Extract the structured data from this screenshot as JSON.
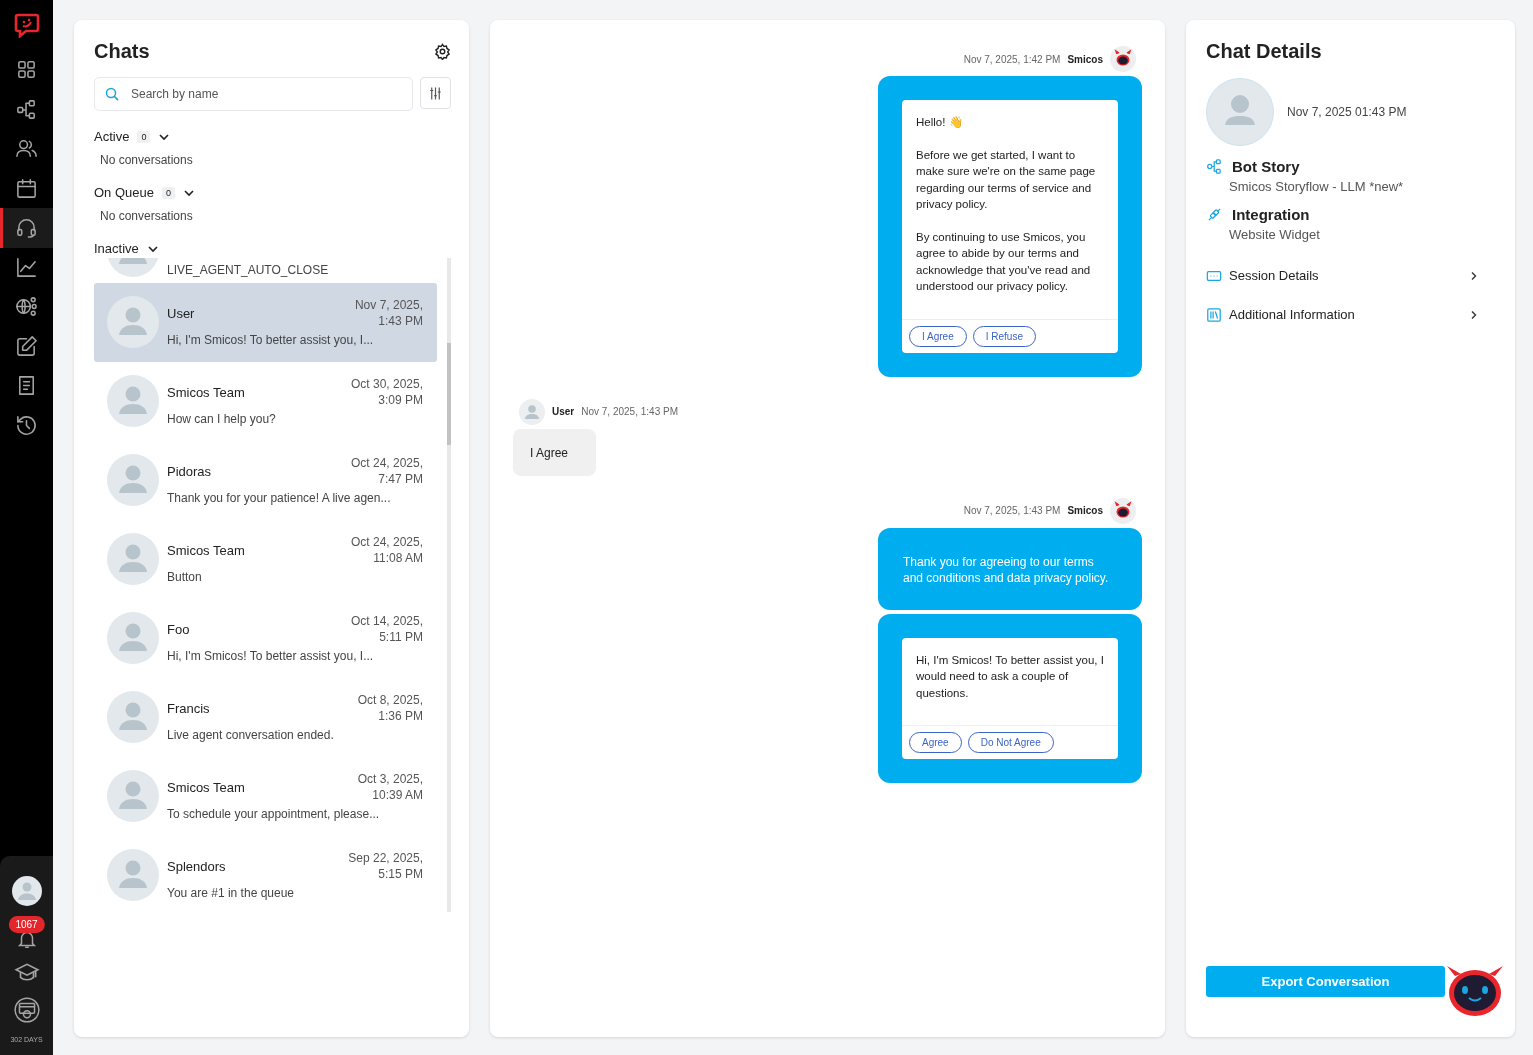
{
  "nav": {
    "items": [
      {
        "selected": false
      },
      {
        "selected": false
      },
      {
        "selected": false
      },
      {
        "selected": false
      },
      {
        "selected": true
      },
      {
        "selected": false
      },
      {
        "selected": false
      },
      {
        "selected": false
      },
      {
        "selected": false
      },
      {
        "selected": false
      }
    ],
    "notifications": "1067",
    "trial": "302 DAYS"
  },
  "chats": {
    "title": "Chats",
    "search": {
      "placeholder": "Search by name"
    },
    "sections": [
      {
        "label": "Active",
        "count": "0",
        "expanded": true,
        "empty": "No conversations"
      },
      {
        "label": "On Queue",
        "count": "0",
        "expanded": true,
        "empty": "No conversations"
      },
      {
        "label": "Inactive",
        "expanded": true
      }
    ],
    "items": [
      {
        "preview": "LIVE_AGENT_AUTO_CLOSE",
        "selected": false
      },
      {
        "name": "User",
        "date": "Nov 7, 2025, 1:43 PM",
        "preview": "Hi, I'm Smicos! To better assist you, I...",
        "selected": true
      },
      {
        "name": "Smicos Team",
        "date": "Oct 30, 2025, 3:09 PM",
        "preview": "How can I help you?",
        "selected": false
      },
      {
        "name": "Pidoras",
        "date": "Oct 24, 2025, 7:47 PM",
        "preview": "Thank you for your patience! A live agen...",
        "selected": false
      },
      {
        "name": "Smicos Team",
        "date": "Oct 24, 2025, 11:08 AM",
        "preview": "Button",
        "selected": false
      },
      {
        "name": "Foo",
        "date": "Oct 14, 2025, 5:11 PM",
        "preview": "Hi, I'm Smicos! To better assist you, I...",
        "selected": false
      },
      {
        "name": "Francis",
        "date": "Oct 8, 2025, 1:36 PM",
        "preview": "Live agent conversation ended.",
        "selected": false
      },
      {
        "name": "Smicos Team",
        "date": "Oct 3, 2025, 10:39 AM",
        "preview": "To schedule your appointment, please...",
        "selected": false
      },
      {
        "name": "Splendors",
        "date": "Sep 22, 2025, 5:15 PM",
        "preview": "You are #1 in the queue",
        "selected": false
      }
    ]
  },
  "conversation": {
    "messages": [
      {
        "kind": "bot",
        "time": "Nov 7, 2025, 1:42 PM",
        "sender": "Smicos",
        "bubbles": [
          {
            "kind": "card",
            "paragraphs": [
              "Hello! 👋",
              "Before we get started, I want to make sure we're on the same page regarding our terms of service and privacy policy.",
              "By continuing to use Smicos, you agree to abide by our terms and acknowledge that you've read and understood our privacy policy."
            ],
            "buttons": [
              "I Agree",
              "I Refuse"
            ]
          }
        ]
      },
      {
        "kind": "user",
        "time": "Nov 7, 2025, 1:43 PM",
        "sender": "User",
        "text": "I Agree"
      },
      {
        "kind": "bot",
        "time": "Nov 7, 2025, 1:43 PM",
        "sender": "Smicos",
        "bubbles": [
          {
            "kind": "text",
            "text": "Thank you for agreeing to our terms and conditions and data privacy policy."
          },
          {
            "kind": "card",
            "paragraphs": [
              "Hi, I'm Smicos! To better assist you, I would need to ask a couple of questions."
            ],
            "buttons": [
              "Agree",
              "Do Not Agree"
            ]
          }
        ]
      }
    ]
  },
  "details": {
    "title": "Chat Details",
    "date": "Nov 7, 2025 01:43 PM",
    "info": [
      {
        "kind": "story",
        "label": "Bot Story",
        "value": "Smicos Storyflow - LLM *new*"
      },
      {
        "kind": "integration",
        "label": "Integration",
        "value": "Website Widget"
      }
    ],
    "links": [
      {
        "kind": "session",
        "label": "Session Details"
      },
      {
        "kind": "additional",
        "label": "Additional Information"
      }
    ],
    "export_button": "Export Conversation"
  }
}
